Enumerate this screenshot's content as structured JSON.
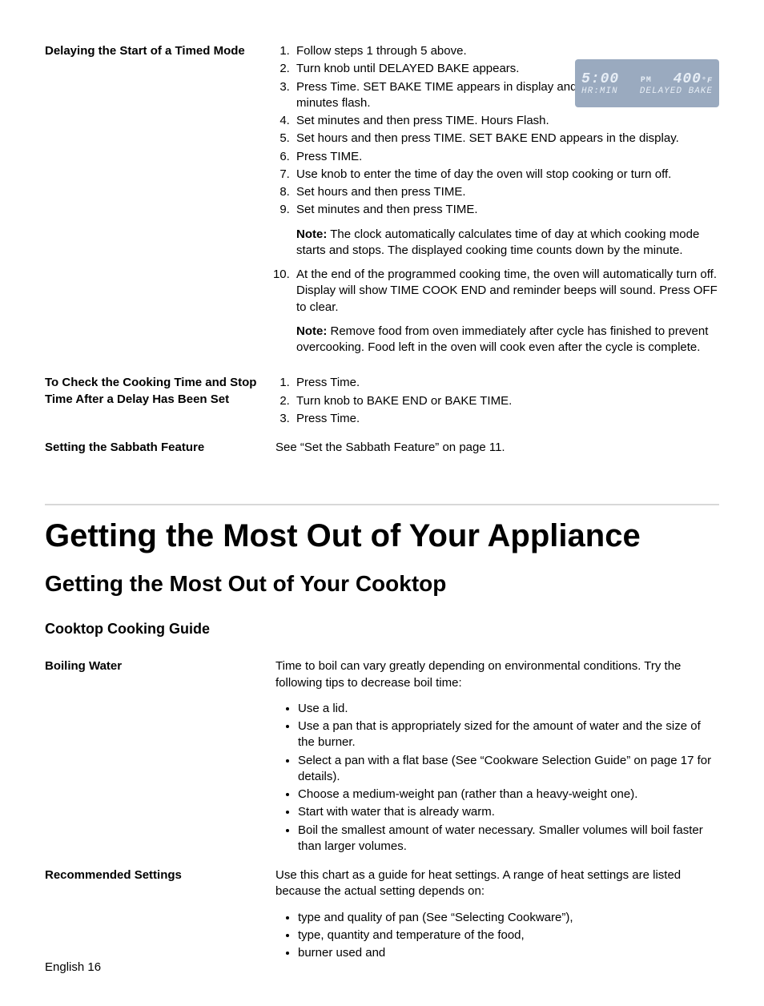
{
  "section1": {
    "heading": "Delaying the Start of a Timed Mode",
    "steps1to9": [
      "Follow steps 1 through 5 above.",
      "Turn knob until DELAYED BAKE appears.",
      "Press Time. SET BAKE TIME appears in display and minutes flash.",
      "Set minutes and then press TIME. Hours Flash.",
      "Set hours and then press TIME. SET BAKE END appears in the display.",
      "Press TIME.",
      "Use knob to enter the time of day the oven will stop cooking or turn off.",
      "Set hours and then press TIME.",
      "Set minutes and then press TIME."
    ],
    "note1_label": "Note:",
    "note1": "The clock automatically calculates time of day at which cooking mode starts and stops. The displayed cooking time counts down by the minute.",
    "step10": "At the end of the programmed cooking time, the oven will automatically turn off. Display will show TIME COOK END and reminder beeps will sound. Press OFF to clear.",
    "note2_label": "Note:",
    "note2": "Remove food from oven immediately after cycle has finished to prevent overcooking. Food left in the oven will cook even after the cycle is complete."
  },
  "display": {
    "time": "5:00",
    "pm": "PM",
    "temp": "400",
    "deg": "°F",
    "hrmin": "HR:MIN",
    "mode": "DELAYED BAKE"
  },
  "section2": {
    "heading": "To Check the Cooking Time and Stop Time After a Delay Has Been Set",
    "steps": [
      "Press Time.",
      "Turn knob to BAKE END or BAKE TIME.",
      "Press Time."
    ]
  },
  "section3": {
    "heading": "Setting the Sabbath Feature",
    "text": "See “Set the Sabbath Feature” on page 11."
  },
  "h1": "Getting the Most Out of Your Appliance",
  "h2": "Getting the Most Out of Your Cooktop",
  "h3": "Cooktop Cooking Guide",
  "boiling": {
    "heading": "Boiling Water",
    "intro": "Time to boil can vary greatly depending on environmental conditions. Try the following tips to decrease boil time:",
    "bullets": [
      "Use a lid.",
      "Use a pan that is appropriately sized for the amount of water and the size of the burner.",
      "Select a pan with a flat base (See “Cookware Selection Guide” on page 17 for details).",
      "Choose a medium-weight pan (rather than a heavy-weight one).",
      "Start with water that is already warm.",
      "Boil the smallest amount of water necessary. Smaller volumes will boil faster than larger volumes."
    ]
  },
  "recommended": {
    "heading": "Recommended Settings",
    "intro": "Use this chart as a guide for heat settings. A range of heat settings are listed because the actual setting depends on:",
    "bullets": [
      "type and quality of pan (See “Selecting Cookware”),",
      "type, quantity and temperature of the food,",
      "burner used and"
    ]
  },
  "footer": "English 16"
}
